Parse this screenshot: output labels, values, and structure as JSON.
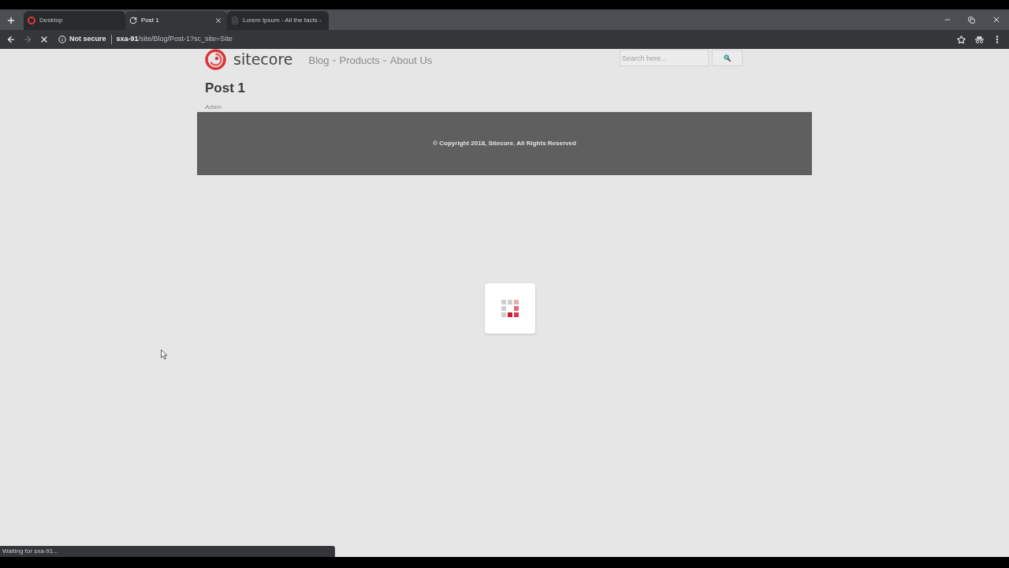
{
  "tabs": [
    {
      "title": "Desktop",
      "kind": "site",
      "selected": false
    },
    {
      "title": "Post 1",
      "kind": "loading",
      "selected": true
    },
    {
      "title": "Lorem Ipsum - All the facts -",
      "kind": "page",
      "selected": false
    }
  ],
  "toolbar": {
    "nav_buttons": [
      {
        "kind": "back",
        "disabled": false
      },
      {
        "kind": "forward",
        "disabled": true
      }
    ],
    "loading": true,
    "security": "Not secure",
    "url_host": "sxa-91",
    "url_path": "/site/Blog/Post-1?sc_site=Site"
  },
  "page": {
    "logo": "sitecore",
    "nav": [
      {
        "label": "Blog",
        "dropdown": true
      },
      {
        "label": "Products",
        "dropdown": true
      },
      {
        "label": "About Us",
        "dropdown": false
      }
    ],
    "search": {
      "placeholder": "Search here..."
    },
    "title": "Post 1",
    "author": "Adam",
    "footer": "© Copyright 2018, Sitecore. All Rights Reserved"
  },
  "status_bar": "Waiting for sxa-91..."
}
